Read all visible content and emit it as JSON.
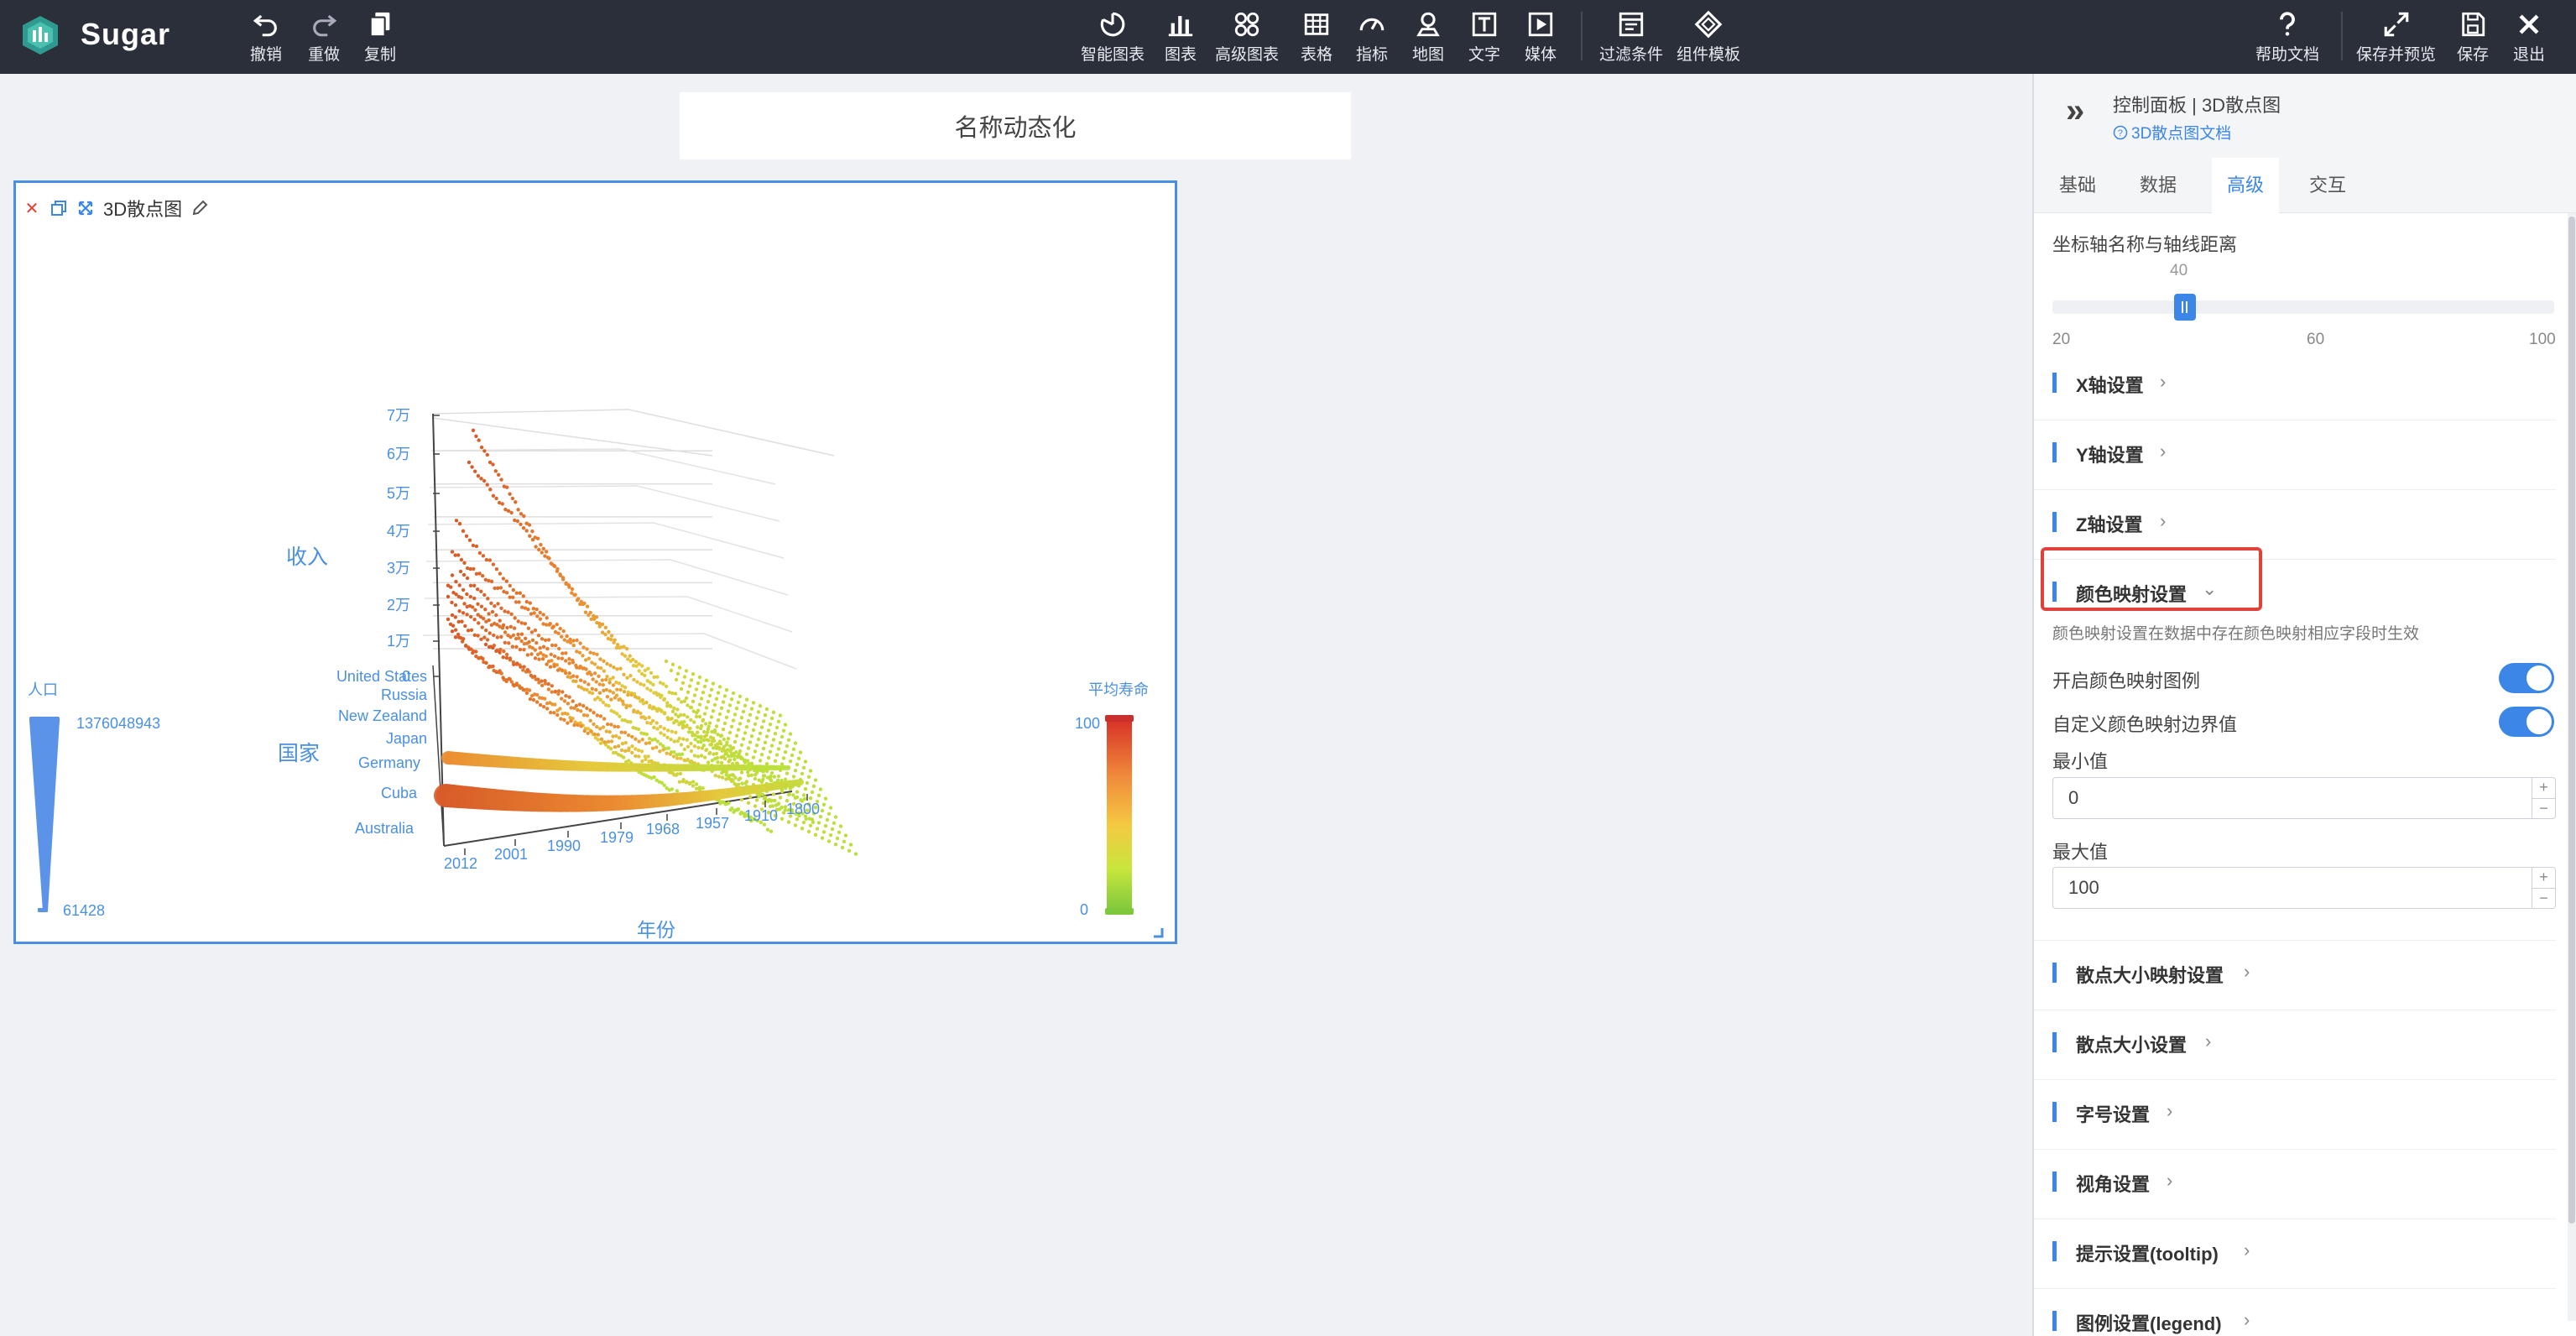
{
  "app": {
    "brand": "Sugar",
    "logo_icon": "sugar-logo-icon"
  },
  "toolbar": {
    "left": [
      {
        "label": "撤销",
        "icon": "undo-icon"
      },
      {
        "label": "重做",
        "icon": "redo-icon"
      },
      {
        "label": "复制",
        "icon": "copy-icon"
      }
    ],
    "center": [
      {
        "label": "智能图表",
        "icon": "smart-chart-icon"
      },
      {
        "label": "图表",
        "icon": "bar-chart-icon"
      },
      {
        "label": "高级图表",
        "icon": "advanced-chart-icon"
      },
      {
        "label": "表格",
        "icon": "table-icon"
      },
      {
        "label": "指标",
        "icon": "gauge-icon"
      },
      {
        "label": "地图",
        "icon": "map-pin-icon"
      },
      {
        "label": "文字",
        "icon": "text-icon"
      },
      {
        "label": "媒体",
        "icon": "media-icon"
      },
      {
        "label": "过滤条件",
        "icon": "filter-icon"
      },
      {
        "label": "组件模板",
        "icon": "template-icon"
      }
    ],
    "right": [
      {
        "label": "帮助文档",
        "icon": "help-icon"
      },
      {
        "label": "保存并预览",
        "icon": "expand-icon"
      },
      {
        "label": "保存",
        "icon": "save-icon"
      },
      {
        "label": "退出",
        "icon": "close-icon"
      }
    ]
  },
  "canvas": {
    "title": "名称动态化",
    "component_title": "3D散点图"
  },
  "chart_data": {
    "type": "scatter",
    "subtype": "3d-scatter",
    "title": "",
    "xlabel": "年份",
    "ylabel": "收入",
    "zlabel": "国家",
    "x_ticks": [
      "2012",
      "2001",
      "1990",
      "1979",
      "1968",
      "1957",
      "1910",
      "1800"
    ],
    "y_ticks": [
      "0",
      "1万",
      "2万",
      "3万",
      "4万",
      "5万",
      "6万",
      "7万"
    ],
    "z_ticks": [
      "United States",
      "Russia",
      "New Zealand",
      "Japan",
      "Germany",
      "Cuba",
      "Australia"
    ],
    "size_legend": {
      "title": "人口",
      "max": "1376048943",
      "min": "61428"
    },
    "color_legend": {
      "title": "平均寿命",
      "max": "100",
      "min": "0",
      "colors": [
        "#d73027",
        "#f08a3b",
        "#f5c842",
        "#c8e63c",
        "#7ec83b"
      ]
    },
    "grid": true
  },
  "panel": {
    "title": "控制面板 | 3D散点图",
    "doc_link": "3D散点图文档",
    "tabs": [
      "基础",
      "数据",
      "高级",
      "交互"
    ],
    "active_tab": "高级",
    "axis_distance": {
      "label": "坐标轴名称与轴线距离",
      "value": "40",
      "ticks": [
        "20",
        "60",
        "100"
      ]
    },
    "sections_top": [
      "X轴设置",
      "Y轴设置",
      "Z轴设置"
    ],
    "color_map": {
      "title": "颜色映射设置",
      "note": "颜色映射设置在数据中存在颜色映射相应字段时生效",
      "enable_legend": "开启颜色映射图例",
      "custom_bounds": "自定义颜色映射边界值",
      "min_label": "最小值",
      "min_value": "0",
      "max_label": "最大值",
      "max_value": "100"
    },
    "sections_bottom": [
      "散点大小映射设置",
      "散点大小设置",
      "字号设置",
      "视角设置",
      "提示设置(tooltip)",
      "图例设置(legend)"
    ]
  }
}
